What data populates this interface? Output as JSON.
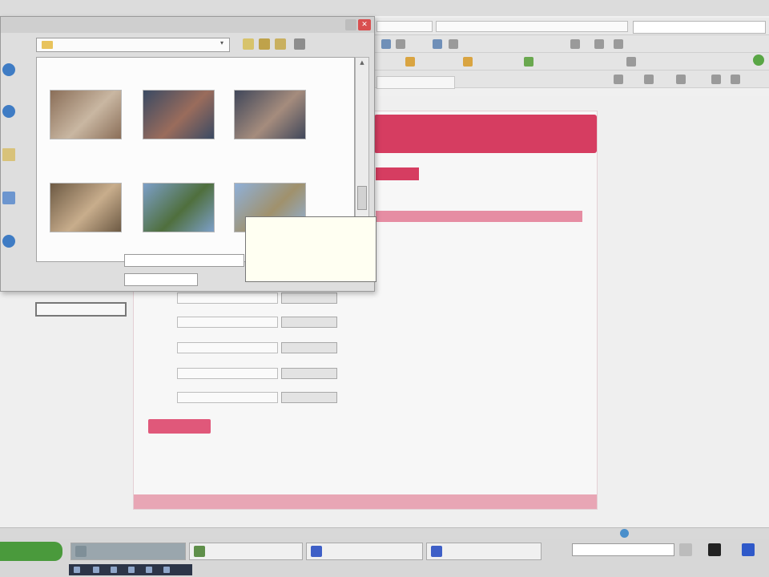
{
  "browser": {
    "search_placeholder": "",
    "status_text": ""
  },
  "page": {
    "header_text": "",
    "badge_text": "",
    "link_text": "",
    "text_block_1": "",
    "text_block_2": "",
    "fields": [
      {
        "label": "",
        "browse": ""
      },
      {
        "label": "",
        "browse": ""
      },
      {
        "label": "",
        "browse": ""
      },
      {
        "label": "",
        "browse": ""
      },
      {
        "label": "",
        "browse": ""
      }
    ],
    "upload_button": "",
    "upload_note": "",
    "footer_text": ""
  },
  "file_dialog": {
    "look_in_label": "",
    "look_in_value": "",
    "places": [
      {
        "label": ""
      },
      {
        "label": ""
      },
      {
        "label": ""
      },
      {
        "label": ""
      },
      {
        "label": ""
      }
    ],
    "files": [
      {
        "label": "",
        "colors": [
          "#8a6e58",
          "#c9b7a2"
        ]
      },
      {
        "label": "",
        "colors": [
          "#3a4a63",
          "#9a6c5c"
        ]
      },
      {
        "label": "",
        "colors": [
          "#40475a",
          "#a58c7d"
        ]
      },
      {
        "label": "",
        "colors": [
          "#6d5a44",
          "#c8ad8c"
        ]
      },
      {
        "label": "",
        "colors": [
          "#7c9fc8",
          "#4f6f3d"
        ]
      },
      {
        "label": "",
        "colors": [
          "#8fb0d8",
          "#a0916c"
        ]
      }
    ],
    "file_name_label": "",
    "file_name_value": "",
    "file_type_label": "",
    "file_type_value": "",
    "tooltip": {
      "title": "",
      "lines": [
        "",
        "",
        "",
        "",
        ""
      ]
    }
  },
  "taskbar": {
    "start_label": "",
    "tasks": [
      {
        "label": ""
      },
      {
        "label": ""
      },
      {
        "label": ""
      },
      {
        "label": ""
      }
    ],
    "search_placeholder": ""
  },
  "colors": {
    "accent": "#d63d61",
    "accent_light": "#e68da3",
    "start_green": "#4a9a3c"
  }
}
